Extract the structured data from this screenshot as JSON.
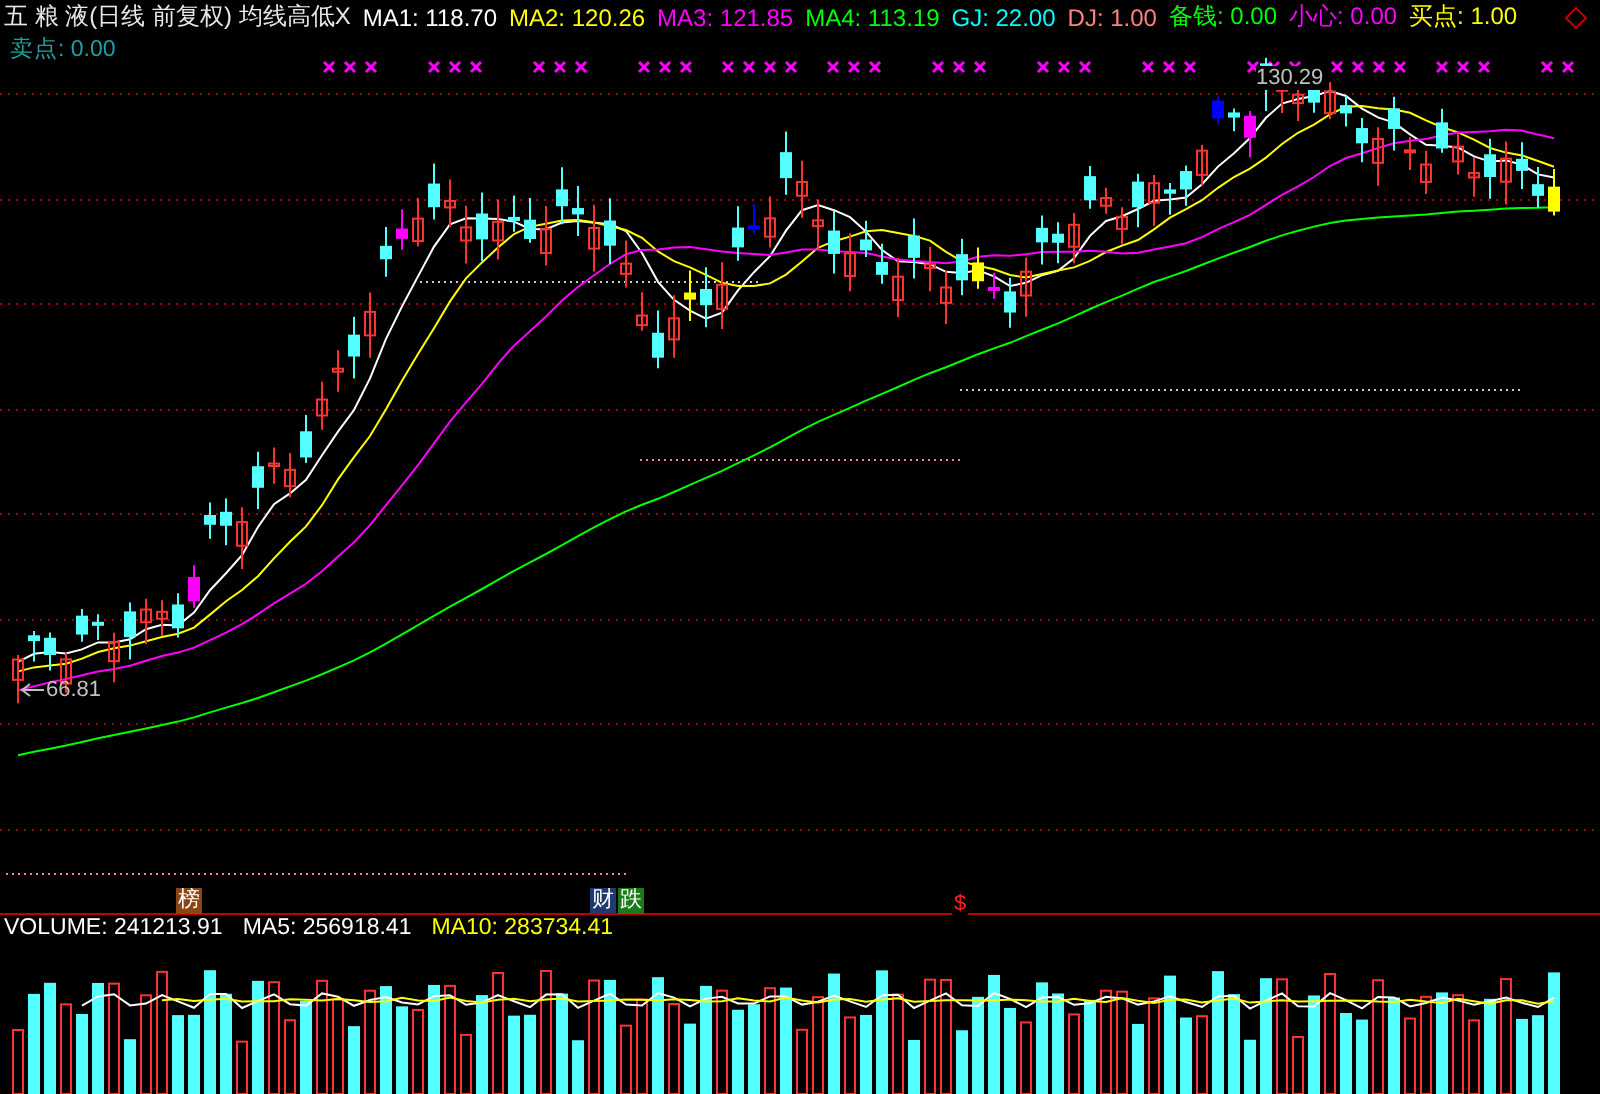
{
  "header": {
    "title": "五 粮 液(日线 前复权) 均线高低X",
    "indicators": [
      {
        "text": "MA1: 118.70",
        "color": "#ffffff"
      },
      {
        "text": "MA2: 120.26",
        "color": "#ffff00"
      },
      {
        "text": "MA3: 121.85",
        "color": "#ff00ff"
      },
      {
        "text": "MA4: 113.19",
        "color": "#00ff00"
      },
      {
        "text": "GJ: 22.00",
        "color": "#00ffff"
      },
      {
        "text": "DJ: 1.00",
        "color": "#ff8080"
      },
      {
        "text": "备钱: 0.00",
        "color": "#00ff00"
      },
      {
        "text": "小心: 0.00",
        "color": "#ff00ff"
      },
      {
        "text": "买点: 1.00",
        "color": "#ffff00"
      }
    ]
  },
  "sell_point": {
    "text": "卖点: 0.00",
    "color": "#20a0a0"
  },
  "price_labels": {
    "high": "130.29",
    "low": "66.81"
  },
  "event_tags": [
    {
      "text": "榜",
      "color": "#8b4513"
    },
    {
      "text": "财",
      "color": "#1e3a6e"
    },
    {
      "text": "跌",
      "color": "#1a7a1a"
    },
    {
      "text": "$",
      "color": "#000000"
    }
  ],
  "volume": {
    "indicators": [
      {
        "text": "VOLUME: 241213.91",
        "color": "#ffffff"
      },
      {
        "text": "MA5: 256918.41",
        "color": "#ffffff"
      },
      {
        "text": "MA10: 283734.41",
        "color": "#ffff00"
      }
    ]
  }
}
